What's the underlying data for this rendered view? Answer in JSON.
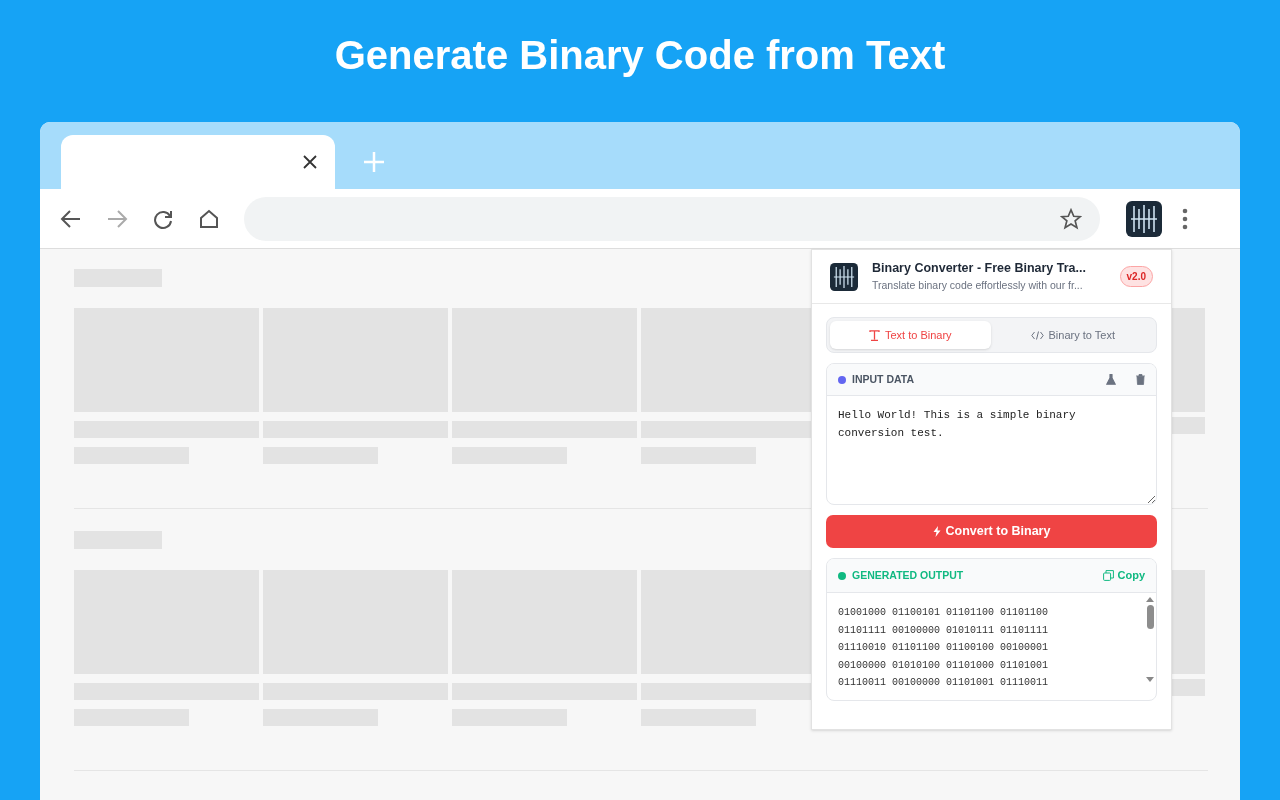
{
  "headline": "Generate Binary Code from Text",
  "popup": {
    "title": "Binary Converter - Free Binary Tra...",
    "subtitle": "Translate binary code effortlessly with our fr...",
    "version": "v2.0",
    "tabs": [
      {
        "label": "Text to Binary",
        "selected": true,
        "kind": "text"
      },
      {
        "label": "Binary to Text",
        "selected": false,
        "kind": "code"
      }
    ],
    "input": {
      "label": "INPUT DATA",
      "color": "#6366f1",
      "value": "Hello World! This is a simple binary conversion test."
    },
    "convert_button": "Convert to Binary",
    "output": {
      "label": "GENERATED OUTPUT",
      "color": "#10b981",
      "copy": "Copy",
      "lines": [
        "01001000 01100101 01101100 01101100",
        "01101111 00100000 01010111 01101111",
        "01110010 01101100 01100100 00100001",
        "00100000 01010100 01101000 01101001",
        "01110011 00100000 01101001 01110011"
      ]
    }
  }
}
